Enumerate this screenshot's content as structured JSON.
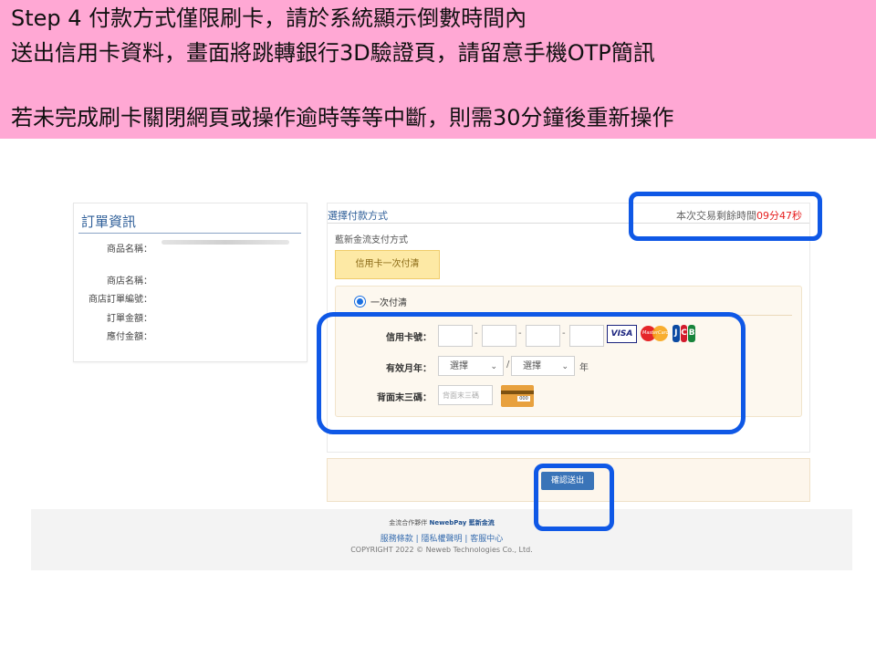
{
  "banner": {
    "line1": "Step 4 付款方式僅限刷卡，請於系統顯示倒數時間內",
    "line2": "送出信用卡資料，畫面將跳轉銀行3D驗證頁，請留意手機OTP簡訊",
    "line3": "若未完成刷卡關閉網頁或操作逾時等等中斷，則需30分鐘後重新操作"
  },
  "order": {
    "title": "訂單資訊",
    "product_label": "商品名稱：",
    "store_label": "商店名稱：",
    "store_order_label": "商店訂單編號：",
    "amount_label": "訂單金額：",
    "payable_label": "應付金額："
  },
  "payment": {
    "title": "選擇付款方式",
    "timer_prefix": "本次交易剩餘時間",
    "timer_value": "09分47秒",
    "subtitle": "藍新金流支付方式",
    "method_button": "信用卡一次付清",
    "radio_label": "一次付清",
    "card_number_label": "信用卡號：",
    "expiry_label": "有效月年：",
    "month_select": "選擇",
    "year_select": "選擇",
    "year_unit": "年",
    "cvv_label": "背面末三碼：",
    "cvv_placeholder": "背面末三碼",
    "logos": {
      "visa": "VISA",
      "mastercard": "MasterCard"
    }
  },
  "confirm": {
    "button": "確認送出"
  },
  "footer": {
    "partner_prefix": "金流合作夥伴",
    "partner_name": "NewebPay 藍新金流",
    "links": "服務條款 | 隱私權聲明 | 客服中心",
    "copyright": "COPYRIGHT 2022 © Neweb Technologies Co., Ltd."
  },
  "colors": {
    "banner_bg": "#ffa8d4",
    "highlight": "#0f58e6",
    "timer_red": "#e62020",
    "button_blue": "#3a74b8"
  }
}
